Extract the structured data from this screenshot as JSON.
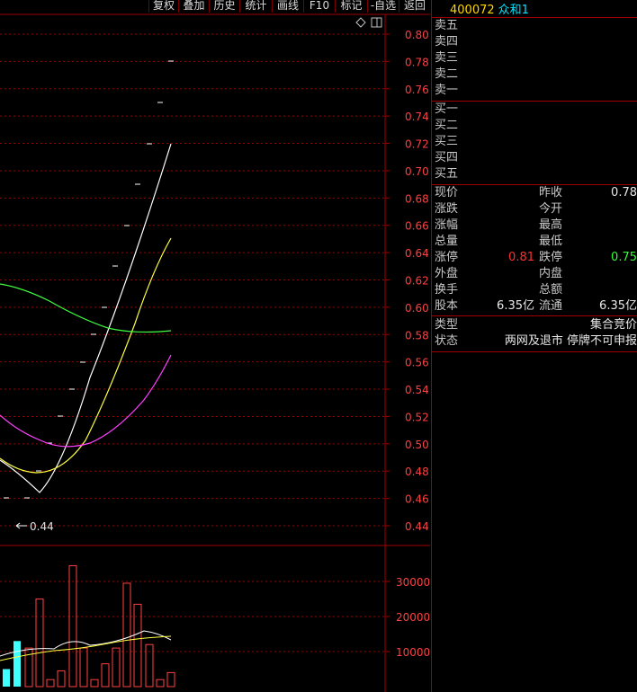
{
  "toolbar": {
    "buttons": [
      "复权",
      "叠加",
      "历史",
      "统计",
      "画线",
      "F10",
      "标记",
      "-自选",
      "返回"
    ]
  },
  "header": {
    "code": "400072",
    "name": "众和1"
  },
  "price_axis": [
    "0.80",
    "0.78",
    "0.76",
    "0.74",
    "0.72",
    "0.70",
    "0.68",
    "0.66",
    "0.64",
    "0.62",
    "0.60",
    "0.58",
    "0.56",
    "0.54",
    "0.52",
    "0.50",
    "0.48",
    "0.46",
    "0.44"
  ],
  "volume_axis": [
    "30000",
    "20000",
    "10000"
  ],
  "low_marker": "0.44",
  "order_book": {
    "sell": [
      "卖五",
      "卖四",
      "卖三",
      "卖二",
      "卖一"
    ],
    "buy": [
      "买一",
      "买二",
      "买三",
      "买四",
      "买五"
    ]
  },
  "quote": {
    "current_label": "现价",
    "prev_close_label": "昨收",
    "prev_close": "0.78",
    "change_label": "涨跌",
    "open_label": "今开",
    "change_pct_label": "涨幅",
    "high_label": "最高",
    "volume_label": "总量",
    "low_label": "最低",
    "limit_up_label": "涨停",
    "limit_up": "0.81",
    "limit_down_label": "跌停",
    "limit_down": "0.75",
    "outer_label": "外盘",
    "inner_label": "内盘",
    "turnover_label": "换手",
    "amount_label": "总额",
    "capital_label": "股本",
    "capital": "6.35亿",
    "float_label": "流通",
    "float": "6.35亿"
  },
  "status": {
    "type_label": "类型",
    "type_value": "集合竞价",
    "state_label": "状态",
    "state_value": "两网及退市 停牌不可申报"
  },
  "colors": {
    "grid": "#a00000",
    "axis_text": "#ff4040",
    "ma_white": "#ffffff",
    "ma_yellow": "#ffff40",
    "ma_magenta": "#ff40ff",
    "ma_green": "#40ff40",
    "vol_red": "#ff4040",
    "vol_cyan": "#40ffff"
  },
  "icons": [
    "diamond-icon",
    "window-icon"
  ]
}
